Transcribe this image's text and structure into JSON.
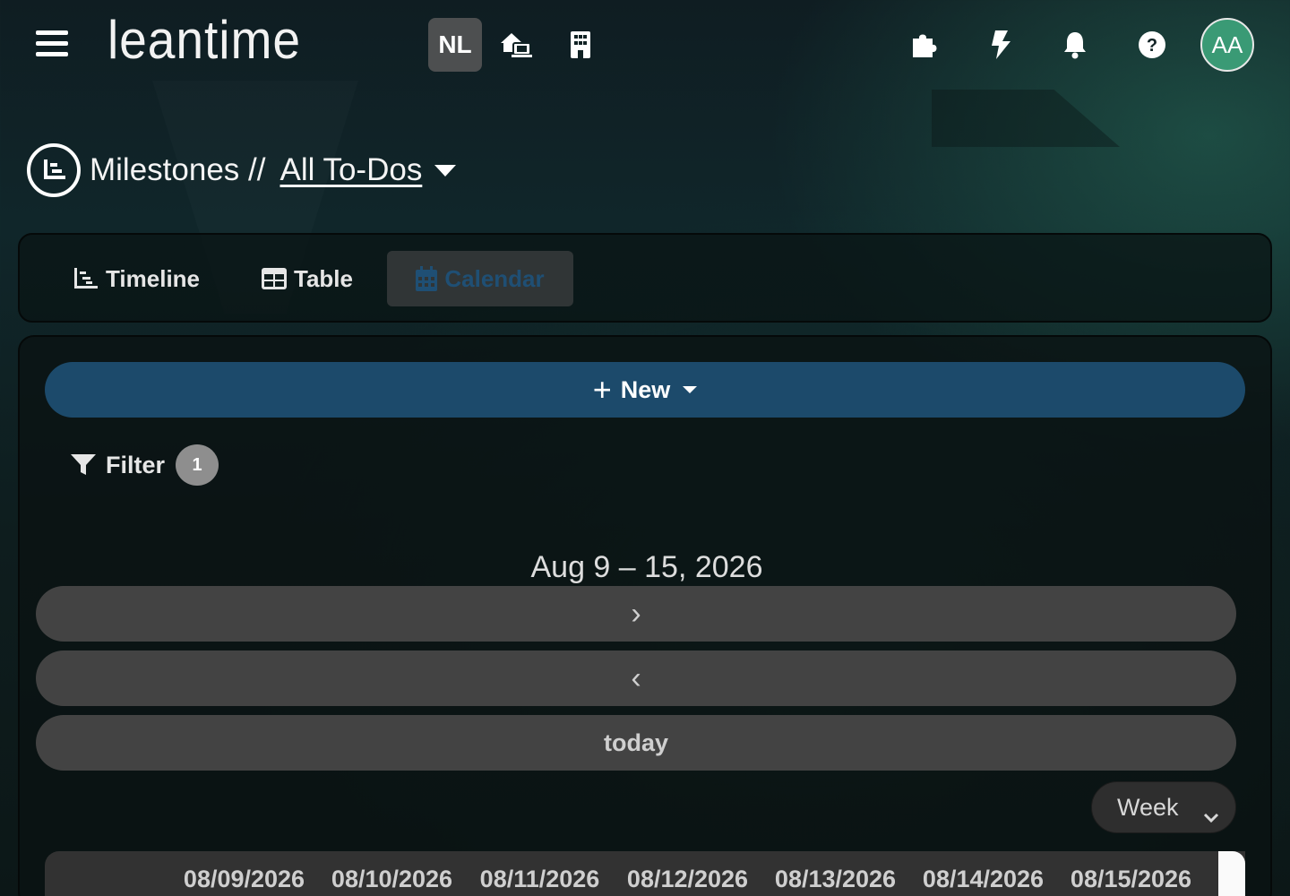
{
  "header": {
    "logo_text": "leantime",
    "project_badge": "NL",
    "avatar_initials": "AA",
    "icons": [
      "menu-icon",
      "home-office-icon",
      "building-icon",
      "puzzle-icon",
      "bolt-icon",
      "bell-icon",
      "help-icon"
    ]
  },
  "page": {
    "title": "Milestones //",
    "view_link": "All To-Dos "
  },
  "tabs": [
    {
      "label": "Timeline",
      "icon": "timeline-icon",
      "active": false
    },
    {
      "label": "Table",
      "icon": "table-icon",
      "active": false
    },
    {
      "label": "Calendar",
      "icon": "calendar-icon",
      "active": true
    }
  ],
  "toolbar": {
    "new_label": "New",
    "filter_label": "Filter",
    "filter_count": "1"
  },
  "calendar": {
    "range_title": "Aug 9 – 15, 2026",
    "next_glyph": "›",
    "prev_glyph": "‹",
    "today_label": "today",
    "view_selected": "Week",
    "days": [
      "08/09/2026",
      "08/10/2026",
      "08/11/2026",
      "08/12/2026",
      "08/13/2026",
      "08/14/2026",
      "08/15/2026"
    ]
  },
  "colors": {
    "primary": "#1c4a6b",
    "avatar": "#3a9a75",
    "button_grey": "#434343"
  }
}
